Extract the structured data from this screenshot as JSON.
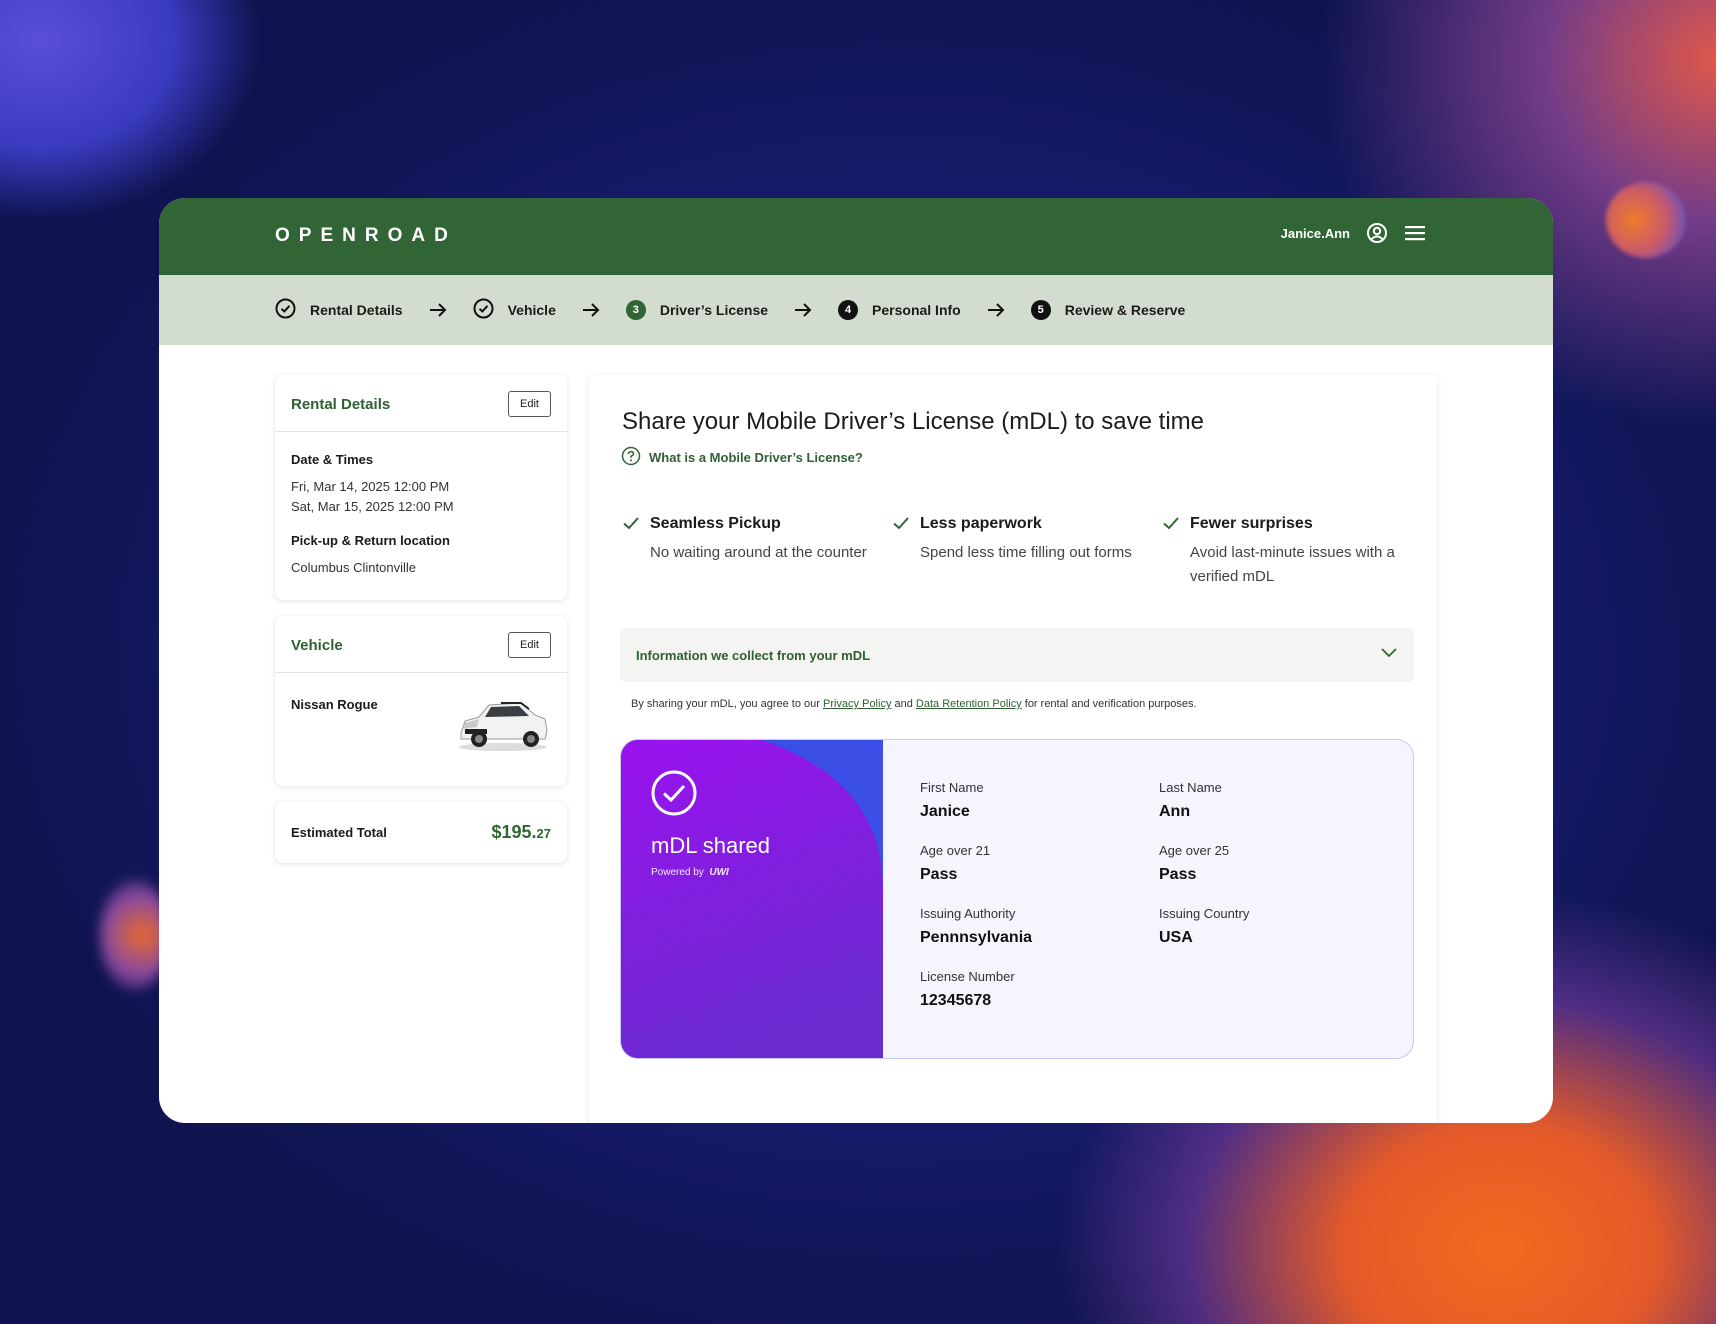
{
  "header": {
    "logo": "OPENROAD",
    "username": "Janice.Ann"
  },
  "steps": [
    {
      "label": "Rental Details",
      "state": "done"
    },
    {
      "label": "Vehicle",
      "state": "done"
    },
    {
      "label": "Driver’s License",
      "state": "active",
      "number": "3"
    },
    {
      "label": "Personal Info",
      "state": "pending",
      "number": "4"
    },
    {
      "label": "Review & Reserve",
      "state": "pending",
      "number": "5"
    }
  ],
  "sidebar": {
    "rental": {
      "title": "Rental Details",
      "edit": "Edit",
      "date_label": "Date & Times",
      "date_start": "Fri, Mar 14, 2025 12:00 PM",
      "date_end": "Sat, Mar 15, 2025 12:00 PM",
      "location_label": "Pick-up & Return location",
      "location": "Columbus Clintonville"
    },
    "vehicle": {
      "title": "Vehicle",
      "edit": "Edit",
      "name": "Nissan Rogue"
    },
    "total": {
      "label": "Estimated Total",
      "dollars": "$195.",
      "cents": "27"
    }
  },
  "main": {
    "title": "Share your Mobile Driver’s License (mDL) to save time",
    "help_link": "What is a Mobile Driver’s License?",
    "benefits": [
      {
        "title": "Seamless Pickup",
        "desc": "No waiting around at the counter"
      },
      {
        "title": "Less paperwork",
        "desc": "Spend less time filling out forms"
      },
      {
        "title": "Fewer surprises",
        "desc": "Avoid last-minute issues with a verified mDL"
      }
    ],
    "accordion": "Information we collect from your mDL",
    "consent": {
      "pre": "By sharing your mDL, you agree to our ",
      "privacy": "Privacy Policy",
      "and": " and ",
      "retention": "Data Retention Policy",
      "post": " for rental and verification purposes."
    },
    "mdl": {
      "status": "mDL shared",
      "powered_by": "Powered by",
      "brand": "UWI",
      "fields": [
        {
          "label": "First Name",
          "value": "Janice"
        },
        {
          "label": "Last Name",
          "value": "Ann"
        },
        {
          "label": "Age over 21",
          "value": "Pass"
        },
        {
          "label": "Age over 25",
          "value": "Pass"
        },
        {
          "label": "Issuing Authority",
          "value": "Pennnsylvania"
        },
        {
          "label": "Issuing Country",
          "value": "USA"
        },
        {
          "label": "License Number",
          "value": "12345678"
        }
      ]
    }
  },
  "colors": {
    "brand_green": "#326535",
    "stepper_bg": "#d2ddcf",
    "mdl_purple": "#8a1ee8",
    "mdl_blue": "#3b4fe6"
  }
}
